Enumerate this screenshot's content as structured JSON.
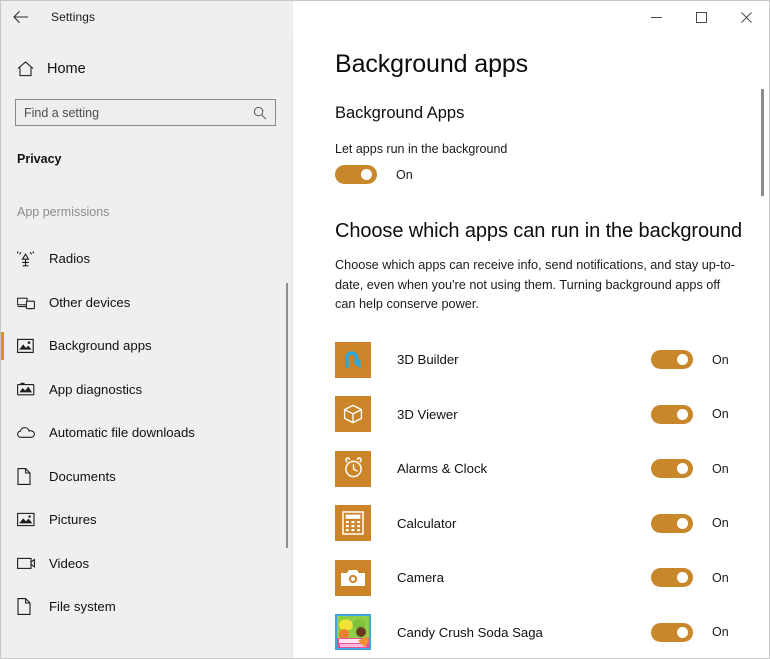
{
  "titlebar": {
    "back_icon": "back-arrow-icon",
    "title": "Settings",
    "minimize_icon": "minimize-icon",
    "maximize_icon": "maximize-icon",
    "close_icon": "close-icon"
  },
  "sidebar": {
    "home": {
      "label": "Home",
      "icon": "home-icon"
    },
    "search": {
      "value": "",
      "placeholder": "Find a setting",
      "icon": "search-icon"
    },
    "section_title": "Privacy",
    "group_title": "App permissions",
    "items": [
      {
        "label": "Radios",
        "icon": "radios-icon",
        "selected": false
      },
      {
        "label": "Other devices",
        "icon": "other-devices-icon",
        "selected": false
      },
      {
        "label": "Background apps",
        "icon": "background-apps-icon",
        "selected": true
      },
      {
        "label": "App diagnostics",
        "icon": "app-diagnostics-icon",
        "selected": false
      },
      {
        "label": "Automatic file downloads",
        "icon": "cloud-download-icon",
        "selected": false
      },
      {
        "label": "Documents",
        "icon": "document-icon",
        "selected": false
      },
      {
        "label": "Pictures",
        "icon": "pictures-icon",
        "selected": false
      },
      {
        "label": "Videos",
        "icon": "videos-icon",
        "selected": false
      },
      {
        "label": "File system",
        "icon": "file-system-icon",
        "selected": false
      }
    ]
  },
  "main": {
    "page_title": "Background apps",
    "section_heading": "Background Apps",
    "master_toggle": {
      "label": "Let apps run in the background",
      "state": "On"
    },
    "choose_heading": "Choose which apps can run in the background",
    "choose_description": "Choose which apps can receive info, send notifications, and stay up-to-date, even when you're not using them. Turning background apps off can help conserve power.",
    "apps": [
      {
        "name": "3D Builder",
        "icon": "3d-builder-icon",
        "state": "On"
      },
      {
        "name": "3D Viewer",
        "icon": "3d-viewer-icon",
        "state": "On"
      },
      {
        "name": "Alarms & Clock",
        "icon": "alarms-clock-icon",
        "state": "On"
      },
      {
        "name": "Calculator",
        "icon": "calculator-icon",
        "state": "On"
      },
      {
        "name": "Camera",
        "icon": "camera-icon",
        "state": "On"
      },
      {
        "name": "Candy Crush Soda Saga",
        "icon": "candy-crush-soda-saga-icon",
        "state": "On"
      }
    ]
  },
  "colors": {
    "accent": "#c8872a",
    "tile": "#cc8428",
    "selection_bar": "#d8922b",
    "sidebar_bg": "#efefef",
    "main_bg": "#ffffff"
  }
}
